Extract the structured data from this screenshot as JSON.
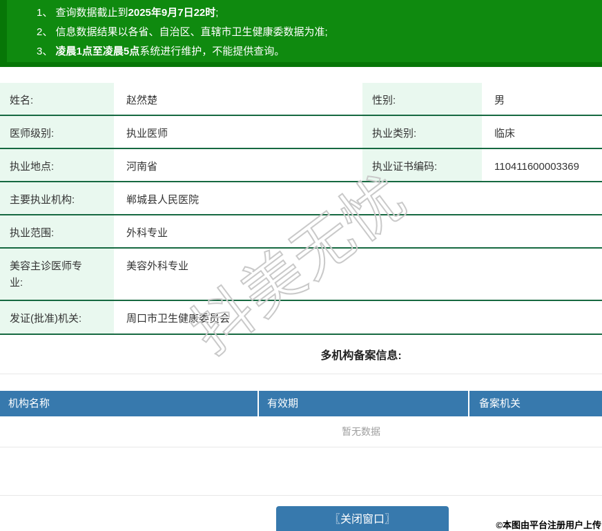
{
  "notices": [
    {
      "pre": "1、 查询数据截止到",
      "bold": "2025年9月7日22时",
      "post": ";"
    },
    {
      "pre": "2、 信息数据结果以各省、自治区、直辖市卫生健康委数据为准;",
      "bold": "",
      "post": ""
    },
    {
      "pre": "3、 ",
      "bold": "凌晨1点至凌晨5点",
      "post": "系统进行维护，不能提供查询。"
    }
  ],
  "doctor": {
    "fields": [
      {
        "label": "姓名:",
        "value": "赵然楚",
        "label2": "性别:",
        "value2": "男"
      },
      {
        "label": "医师级别:",
        "value": "执业医师",
        "label2": "执业类别:",
        "value2": "临床"
      },
      {
        "label": "执业地点:",
        "value": "河南省",
        "label2": "执业证书编码:",
        "value2": "110411600003369"
      },
      {
        "label": "主要执业机构:",
        "value": "郸城县人民医院"
      },
      {
        "label": "执业范围:",
        "value": "外科专业"
      },
      {
        "label": "美容主诊医师专业:",
        "value": "美容外科专业"
      },
      {
        "label": "发证(批准)机关:",
        "value": "周口市卫生健康委员会"
      }
    ]
  },
  "records_section": {
    "title": "多机构备案信息:",
    "headers": [
      "机构名称",
      "有效期",
      "备案机关"
    ],
    "empty_text": "暂无数据"
  },
  "close_button_label": "〖关闭窗口〗",
  "watermark_text": "抖美无忧",
  "copyright_text": "©本图由平台注册用户上传",
  "colors": {
    "banner_green": "#0f8a0f",
    "banner_green_dark": "#077607",
    "table_border_green": "#156840",
    "label_cell_bg": "#e9f8ef",
    "header_blue": "#3779ad",
    "button_blue": "#3779ad",
    "empty_text_gray": "#9f9f9f"
  }
}
